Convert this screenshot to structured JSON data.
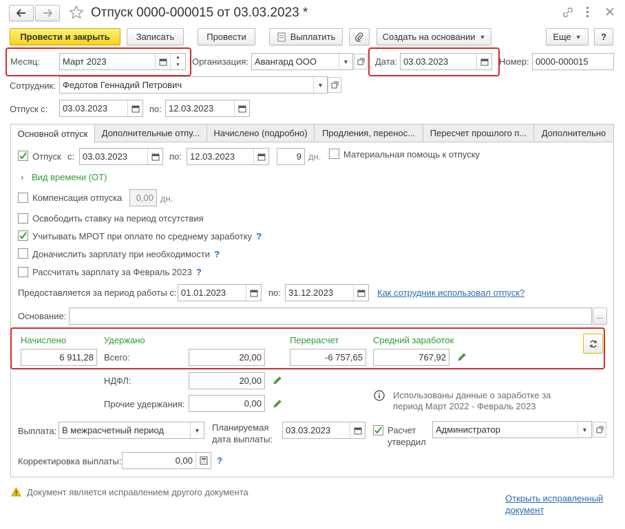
{
  "window": {
    "title": "Отпуск 0000-000015 от 03.03.2023 *"
  },
  "toolbar": {
    "post_close": "Провести и закрыть",
    "save": "Записать",
    "post": "Провести",
    "pay": "Выплатить",
    "create_based": "Создать на основании",
    "more": "Еще",
    "help": "?"
  },
  "header": {
    "month_label": "Месяц:",
    "month_value": "Март 2023",
    "org_label": "Организация:",
    "org_value": "Авангард ООО",
    "date_label": "Дата:",
    "date_value": "03.03.2023",
    "number_label": "Номер:",
    "number_value": "0000-000015",
    "employee_label": "Сотрудник:",
    "employee_value": "Федотов Геннадий Петрович",
    "vac_from_label": "Отпуск с:",
    "vac_from_value": "03.03.2023",
    "vac_to_label": "по:",
    "vac_to_value": "12.03.2023"
  },
  "tabs": [
    {
      "label": "Основной отпуск"
    },
    {
      "label": "Дополнительные отпу..."
    },
    {
      "label": "Начислено (подробно)"
    },
    {
      "label": "Продления, перенос..."
    },
    {
      "label": "Пересчет прошлого п..."
    },
    {
      "label": "Дополнительно"
    }
  ],
  "main": {
    "leave_label": "Отпуск",
    "leave_from_label": "с:",
    "leave_from": "03.03.2023",
    "leave_to_label": "по:",
    "leave_to": "12.03.2023",
    "days": "9",
    "days_unit": "дн.",
    "material_aid": "Материальная помощь к отпуску",
    "time_type": "Вид времени (ОТ)",
    "compensation": "Компенсация отпуска",
    "compensation_days": "0,00",
    "compensation_unit": "дн.",
    "release_rate": "Освободить ставку на период отсутствия",
    "mrot": "Учитывать МРОТ при оплате по среднему заработку",
    "mrot_q": "?",
    "accrue_salary": "Доначислить зарплату при необходимости",
    "accrue_q": "?",
    "calc_salary": "Рассчитать зарплату за Февраль 2023",
    "calc_q": "?",
    "period_label": "Предоставляется за период работы с:",
    "period_from": "01.01.2023",
    "period_to_label": "по:",
    "period_to": "31.12.2023",
    "how_used_link": "Как сотрудник использовал отпуск?",
    "basis_label": "Основание:",
    "basis_value": "",
    "basis_btn": "..."
  },
  "totals": {
    "accrued_label": "Начислено",
    "accrued_value": "6 911,28",
    "withheld_label": "Удержано",
    "total_label": "Всего:",
    "total_value": "20,00",
    "recalc_label": "Перерасчет",
    "recalc_value": "-6 757,65",
    "avg_label": "Средний заработок",
    "avg_value": "767,92",
    "ndfl_label": "НДФЛ:",
    "ndfl_value": "20,00",
    "other_label": "Прочие удержания:",
    "other_value": "0,00",
    "info_text_1": "Использованы данные о заработке за",
    "info_text_2": "период Март 2022 - Февраль 2023"
  },
  "payment": {
    "payout_label": "Выплата:",
    "payout_value": "В межрасчетный период",
    "planned_label_1": "Планируемая",
    "planned_label_2": "дата выплаты:",
    "planned_value": "03.03.2023",
    "approved_label_1": "Расчет",
    "approved_label_2": "утвердил",
    "approved_value": "Администратор",
    "correction_label": "Корректировка выплаты:",
    "correction_value": "0,00",
    "correction_q": "?"
  },
  "footer": {
    "warning": "Документ является исправлением другого документа",
    "open_link_1": "Открыть исправленный",
    "open_link_2": "документ"
  },
  "colors": {
    "primary_button": "#f5d21a",
    "highlight_border": "#d42b2b",
    "green_text": "#2f9b38",
    "link": "#2a6db3"
  }
}
